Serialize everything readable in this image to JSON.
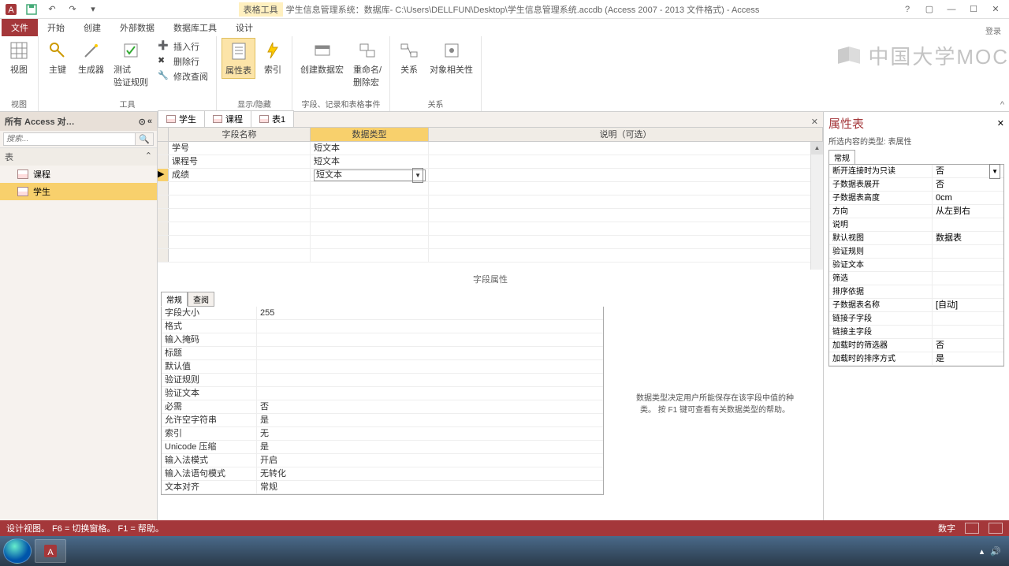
{
  "titlebar": {
    "context_tool": "表格工具",
    "title_text": "学生信息管理系统：数据库- C:\\Users\\DELLFUN\\Desktop\\学生信息管理系统.accdb (Access 2007 - 2013 文件格式) - Access",
    "login": "登录"
  },
  "ribbon_tabs": {
    "file": "文件",
    "home": "开始",
    "create": "创建",
    "external": "外部数据",
    "dbtools": "数据库工具",
    "design": "设计"
  },
  "ribbon": {
    "view": "视图",
    "primary_key": "主键",
    "builder": "生成器",
    "test_rules": "测试\n验证规则",
    "insert_row": "插入行",
    "delete_row": "删除行",
    "modify_lookup": "修改查阅",
    "property_sheet": "属性表",
    "indexes": "索引",
    "create_macros": "创建数据宏",
    "rename_delete": "重命名/\n删除宏",
    "relationships": "关系",
    "obj_depend": "对象相关性",
    "grp_view": "视图",
    "grp_tools": "工具",
    "grp_showhide": "显示/隐藏",
    "grp_events": "字段、记录和表格事件",
    "grp_rel": "关系"
  },
  "watermark": "中国大学MOC",
  "navpane": {
    "title": "所有 Access 对…",
    "search_ph": "搜索...",
    "group": "表",
    "items": [
      "课程",
      "学生"
    ]
  },
  "doctabs": [
    "学生",
    "课程",
    "表1"
  ],
  "design_grid": {
    "col_name": "字段名称",
    "col_type": "数据类型",
    "col_desc": "说明（可选）",
    "rows": [
      {
        "name": "学号",
        "type": "短文本"
      },
      {
        "name": "课程号",
        "type": "短文本"
      },
      {
        "name": "成绩",
        "type": "短文本"
      }
    ]
  },
  "field_props_title": "字段属性",
  "fp_tabs": {
    "general": "常规",
    "lookup": "查阅"
  },
  "fp_rows": [
    {
      "k": "字段大小",
      "v": "255"
    },
    {
      "k": "格式",
      "v": ""
    },
    {
      "k": "输入掩码",
      "v": ""
    },
    {
      "k": "标题",
      "v": ""
    },
    {
      "k": "默认值",
      "v": ""
    },
    {
      "k": "验证规则",
      "v": ""
    },
    {
      "k": "验证文本",
      "v": ""
    },
    {
      "k": "必需",
      "v": "否"
    },
    {
      "k": "允许空字符串",
      "v": "是"
    },
    {
      "k": "索引",
      "v": "无"
    },
    {
      "k": "Unicode 压缩",
      "v": "是"
    },
    {
      "k": "输入法模式",
      "v": "开启"
    },
    {
      "k": "输入法语句模式",
      "v": "无转化"
    },
    {
      "k": "文本对齐",
      "v": "常规"
    }
  ],
  "fp_help": "数据类型决定用户所能保存在该字段中值的种类。 按 F1 键可查看有关数据类型的帮助。",
  "propsheet": {
    "title": "属性表",
    "subtitle": "所选内容的类型: 表属性",
    "tab": "常规",
    "rows": [
      {
        "k": "断开连接时为只读",
        "v": "否",
        "dd": true
      },
      {
        "k": "子数据表展开",
        "v": "否"
      },
      {
        "k": "子数据表高度",
        "v": "0cm"
      },
      {
        "k": "方向",
        "v": "从左到右"
      },
      {
        "k": "说明",
        "v": ""
      },
      {
        "k": "默认视图",
        "v": "数据表"
      },
      {
        "k": "验证规则",
        "v": ""
      },
      {
        "k": "验证文本",
        "v": ""
      },
      {
        "k": "筛选",
        "v": ""
      },
      {
        "k": "排序依据",
        "v": ""
      },
      {
        "k": "子数据表名称",
        "v": "[自动]"
      },
      {
        "k": "链接子字段",
        "v": ""
      },
      {
        "k": "链接主字段",
        "v": ""
      },
      {
        "k": "加载时的筛选器",
        "v": "否"
      },
      {
        "k": "加载时的排序方式",
        "v": "是"
      }
    ]
  },
  "statusbar": {
    "left": "设计视图。  F6 = 切换窗格。  F1 = 帮助。",
    "right": "数字"
  }
}
